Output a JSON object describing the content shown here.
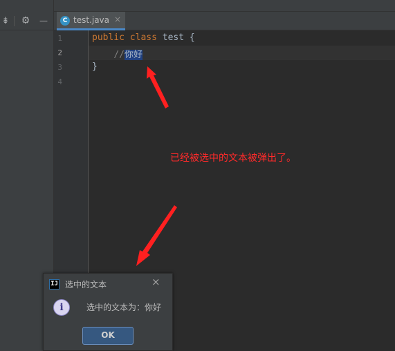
{
  "toolbar": {
    "collapse_icon": "collapse-icon",
    "settings_icon": "gear-icon",
    "hide_icon": "minimize-icon",
    "collapse_glyph": "⇟",
    "settings_glyph": "⚙",
    "hide_glyph": "—"
  },
  "editor": {
    "tab": {
      "icon_letter": "C",
      "label": "test.java",
      "close_glyph": "×"
    },
    "line_numbers": [
      "1",
      "2",
      "3",
      "4"
    ],
    "lines": {
      "l1_kw1": "public",
      "l1_kw2": "class",
      "l1_name": "test",
      "l1_brace": "{",
      "l2_comment": "//",
      "l2_selected": "你好",
      "l3_brace": "}"
    },
    "selection_color": "#214283"
  },
  "annotation": {
    "text": "已经被选中的文本被弹出了。",
    "color": "#ff2a2a"
  },
  "dialog": {
    "title": "选中的文本",
    "app_icon_letter": "IJ",
    "close_glyph": "×",
    "info_glyph": "i",
    "message": "选中的文本为：你好",
    "ok_label": "OK"
  }
}
